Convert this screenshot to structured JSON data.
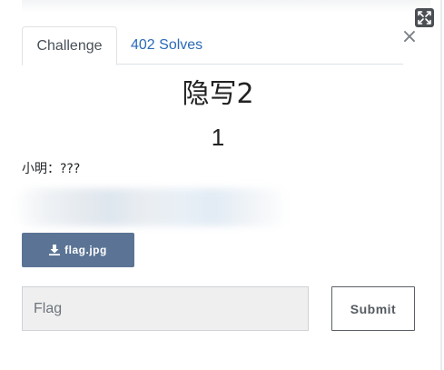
{
  "modal": {
    "close_symbol": "×",
    "expand_icon": "expand-icon"
  },
  "tabs": [
    {
      "label": "Challenge",
      "active": true
    },
    {
      "label": "402 Solves",
      "active": false
    }
  ],
  "challenge": {
    "name": "隐写2",
    "value": "1",
    "description": "小明：???"
  },
  "download": {
    "label": "flag.jpg",
    "icon": "download-icon"
  },
  "submission": {
    "placeholder": "Flag",
    "value": "",
    "submit_label": "Submit"
  },
  "colors": {
    "tab_link": "#2b6ab8",
    "download_button_bg": "#5b7495",
    "input_bg": "#efefef"
  }
}
